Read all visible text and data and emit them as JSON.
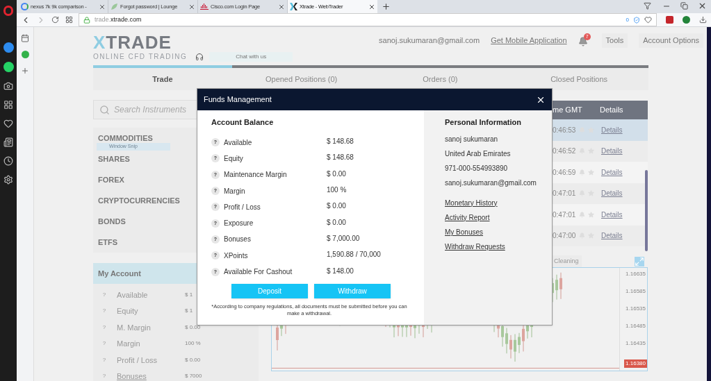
{
  "browser": {
    "tabs": [
      {
        "title": "nexus 7k 9k comparison -",
        "kind": "google",
        "selected": false
      },
      {
        "title": "Forgot password | Lounge",
        "kind": "lounge",
        "selected": false
      },
      {
        "title": "Cisco.com Login Page",
        "kind": "cisco",
        "selected": false
      },
      {
        "title": "Xtrade - WebTrader",
        "kind": "xtrade",
        "selected": true
      }
    ],
    "url_prefix": "trade.",
    "url_domain": "xtrade.com",
    "blocked_count": "0"
  },
  "header": {
    "logo_x": "X",
    "logo_rest": "TRADE",
    "logo_subtitle": "ONLINE CFD TRADING",
    "chat": "Chat with us",
    "email": "sanoj.sukumaran@gmail.com",
    "mobile_link": "Get Mobile Application",
    "notifications": "7",
    "menu": [
      "Tools",
      "Account Options"
    ]
  },
  "main_tabs": [
    {
      "label": "Trade",
      "selected": true
    },
    {
      "label": "Opened Positions (0)",
      "selected": false
    },
    {
      "label": "Orders (0)",
      "selected": false
    },
    {
      "label": "Closed Positions",
      "selected": false
    }
  ],
  "search": {
    "placeholder": "Search Instruments"
  },
  "categories": [
    "COMMODITIES",
    "SHARES",
    "FOREX",
    "CRYPTOCURRENCIES",
    "BONDS",
    "ETFS"
  ],
  "snip_tooltip": "Window Snip",
  "my_account": {
    "title": "My Account",
    "rows": [
      {
        "help": "?",
        "label": "Available",
        "value": "$ 1",
        "link": false
      },
      {
        "help": "?",
        "label": "Equity",
        "value": "$ 1",
        "link": false
      },
      {
        "help": "?",
        "label": "M. Margin",
        "value": "$ 0.00",
        "link": false
      },
      {
        "help": "?",
        "label": "Margin",
        "value": "100 %",
        "link": false
      },
      {
        "help": "?",
        "label": "Profit / Loss",
        "value": "$ 0.00",
        "link": false
      },
      {
        "help": "?",
        "label": "Bonuses",
        "value": "$ 7000",
        "link": true
      }
    ]
  },
  "table": {
    "columns": [
      "me GMT",
      "Details"
    ],
    "rows": [
      {
        "time": "0:46:53",
        "details": "Details",
        "selected": true
      },
      {
        "time": "0:46:52",
        "details": "Details",
        "selected": false
      },
      {
        "time": "0:46:59",
        "details": "Details",
        "selected": false
      },
      {
        "time": "0:47:01",
        "details": "Details",
        "selected": false
      },
      {
        "time": "0:47:01",
        "details": "Details",
        "selected": false
      },
      {
        "time": "0:47:00",
        "details": "Details",
        "selected": false
      }
    ]
  },
  "chart": {
    "tab": "Cleaning",
    "price_labels": [
      "1.16635",
      "1.16585",
      "1.16535",
      "1.16485",
      "1.16435"
    ],
    "current_price": "1.16380"
  },
  "modal": {
    "title": "Funds Management",
    "balance_title": "Account Balance",
    "rows": [
      {
        "help": "?",
        "label": "Available",
        "value": "$ 148.68"
      },
      {
        "help": "?",
        "label": "Equity",
        "value": "$ 148.68"
      },
      {
        "help": "?",
        "label": "Maintenance Margin",
        "value": "$ 0.00"
      },
      {
        "help": "?",
        "label": "Margin",
        "value": "100 %"
      },
      {
        "help": "?",
        "label": "Profit / Loss",
        "value": "$ 0.00"
      },
      {
        "help": "?",
        "label": "Exposure",
        "value": "$ 0.00"
      },
      {
        "help": "?",
        "label": "Bonuses",
        "value": "$ 7,000.00"
      },
      {
        "help": "?",
        "label": "XPoints",
        "value": "1,590.88 / 70,000"
      },
      {
        "help": "?",
        "label": "Available For Cashout",
        "value": "$ 148.00"
      }
    ],
    "buttons": [
      "Deposit",
      "Withdraw"
    ],
    "note": "*According to company regulations, all documents must be submitted before you can make a withdrawal.",
    "personal_title": "Personal Information",
    "personal": [
      "sanoj sukumaran",
      "United Arab Emirates",
      "971-000-554993890",
      "sanoj.sukumaran@gmail.com"
    ],
    "links": [
      "Monetary History",
      "Activity Report",
      "My Bonuses",
      "Withdraw Requests"
    ]
  }
}
